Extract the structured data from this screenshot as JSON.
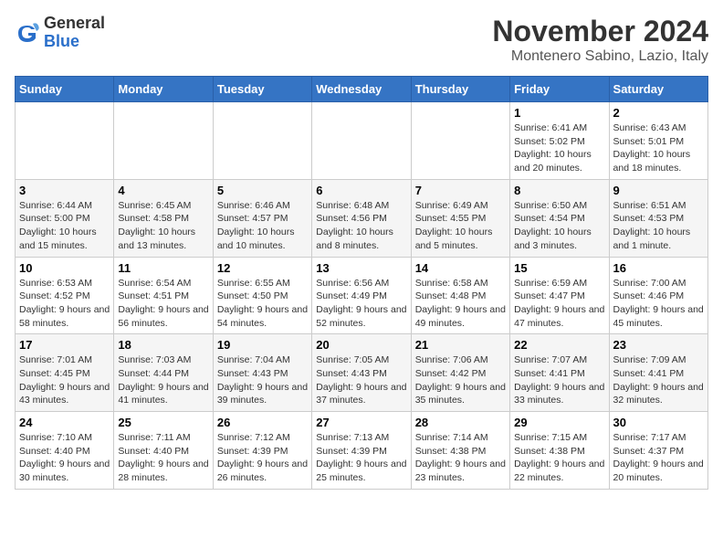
{
  "logo": {
    "general": "General",
    "blue": "Blue"
  },
  "title": "November 2024",
  "location": "Montenero Sabino, Lazio, Italy",
  "days_header": [
    "Sunday",
    "Monday",
    "Tuesday",
    "Wednesday",
    "Thursday",
    "Friday",
    "Saturday"
  ],
  "weeks": [
    [
      {
        "day": "",
        "info": ""
      },
      {
        "day": "",
        "info": ""
      },
      {
        "day": "",
        "info": ""
      },
      {
        "day": "",
        "info": ""
      },
      {
        "day": "",
        "info": ""
      },
      {
        "day": "1",
        "info": "Sunrise: 6:41 AM\nSunset: 5:02 PM\nDaylight: 10 hours and 20 minutes."
      },
      {
        "day": "2",
        "info": "Sunrise: 6:43 AM\nSunset: 5:01 PM\nDaylight: 10 hours and 18 minutes."
      }
    ],
    [
      {
        "day": "3",
        "info": "Sunrise: 6:44 AM\nSunset: 5:00 PM\nDaylight: 10 hours and 15 minutes."
      },
      {
        "day": "4",
        "info": "Sunrise: 6:45 AM\nSunset: 4:58 PM\nDaylight: 10 hours and 13 minutes."
      },
      {
        "day": "5",
        "info": "Sunrise: 6:46 AM\nSunset: 4:57 PM\nDaylight: 10 hours and 10 minutes."
      },
      {
        "day": "6",
        "info": "Sunrise: 6:48 AM\nSunset: 4:56 PM\nDaylight: 10 hours and 8 minutes."
      },
      {
        "day": "7",
        "info": "Sunrise: 6:49 AM\nSunset: 4:55 PM\nDaylight: 10 hours and 5 minutes."
      },
      {
        "day": "8",
        "info": "Sunrise: 6:50 AM\nSunset: 4:54 PM\nDaylight: 10 hours and 3 minutes."
      },
      {
        "day": "9",
        "info": "Sunrise: 6:51 AM\nSunset: 4:53 PM\nDaylight: 10 hours and 1 minute."
      }
    ],
    [
      {
        "day": "10",
        "info": "Sunrise: 6:53 AM\nSunset: 4:52 PM\nDaylight: 9 hours and 58 minutes."
      },
      {
        "day": "11",
        "info": "Sunrise: 6:54 AM\nSunset: 4:51 PM\nDaylight: 9 hours and 56 minutes."
      },
      {
        "day": "12",
        "info": "Sunrise: 6:55 AM\nSunset: 4:50 PM\nDaylight: 9 hours and 54 minutes."
      },
      {
        "day": "13",
        "info": "Sunrise: 6:56 AM\nSunset: 4:49 PM\nDaylight: 9 hours and 52 minutes."
      },
      {
        "day": "14",
        "info": "Sunrise: 6:58 AM\nSunset: 4:48 PM\nDaylight: 9 hours and 49 minutes."
      },
      {
        "day": "15",
        "info": "Sunrise: 6:59 AM\nSunset: 4:47 PM\nDaylight: 9 hours and 47 minutes."
      },
      {
        "day": "16",
        "info": "Sunrise: 7:00 AM\nSunset: 4:46 PM\nDaylight: 9 hours and 45 minutes."
      }
    ],
    [
      {
        "day": "17",
        "info": "Sunrise: 7:01 AM\nSunset: 4:45 PM\nDaylight: 9 hours and 43 minutes."
      },
      {
        "day": "18",
        "info": "Sunrise: 7:03 AM\nSunset: 4:44 PM\nDaylight: 9 hours and 41 minutes."
      },
      {
        "day": "19",
        "info": "Sunrise: 7:04 AM\nSunset: 4:43 PM\nDaylight: 9 hours and 39 minutes."
      },
      {
        "day": "20",
        "info": "Sunrise: 7:05 AM\nSunset: 4:43 PM\nDaylight: 9 hours and 37 minutes."
      },
      {
        "day": "21",
        "info": "Sunrise: 7:06 AM\nSunset: 4:42 PM\nDaylight: 9 hours and 35 minutes."
      },
      {
        "day": "22",
        "info": "Sunrise: 7:07 AM\nSunset: 4:41 PM\nDaylight: 9 hours and 33 minutes."
      },
      {
        "day": "23",
        "info": "Sunrise: 7:09 AM\nSunset: 4:41 PM\nDaylight: 9 hours and 32 minutes."
      }
    ],
    [
      {
        "day": "24",
        "info": "Sunrise: 7:10 AM\nSunset: 4:40 PM\nDaylight: 9 hours and 30 minutes."
      },
      {
        "day": "25",
        "info": "Sunrise: 7:11 AM\nSunset: 4:40 PM\nDaylight: 9 hours and 28 minutes."
      },
      {
        "day": "26",
        "info": "Sunrise: 7:12 AM\nSunset: 4:39 PM\nDaylight: 9 hours and 26 minutes."
      },
      {
        "day": "27",
        "info": "Sunrise: 7:13 AM\nSunset: 4:39 PM\nDaylight: 9 hours and 25 minutes."
      },
      {
        "day": "28",
        "info": "Sunrise: 7:14 AM\nSunset: 4:38 PM\nDaylight: 9 hours and 23 minutes."
      },
      {
        "day": "29",
        "info": "Sunrise: 7:15 AM\nSunset: 4:38 PM\nDaylight: 9 hours and 22 minutes."
      },
      {
        "day": "30",
        "info": "Sunrise: 7:17 AM\nSunset: 4:37 PM\nDaylight: 9 hours and 20 minutes."
      }
    ]
  ]
}
